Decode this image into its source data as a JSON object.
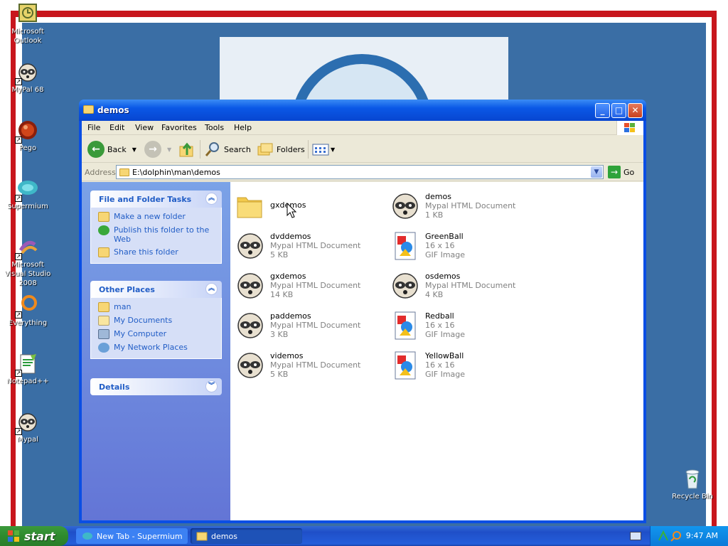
{
  "desktop": {
    "icons": [
      {
        "label": "Microsoft Outlook",
        "icon": "outlook-icon"
      },
      {
        "label": "MyPal 68",
        "icon": "raccoon-icon"
      },
      {
        "label": "Pego",
        "icon": "pego-icon"
      },
      {
        "label": "Supermium",
        "icon": "supermium-icon"
      },
      {
        "label": "Microsoft Visual Studio 2008",
        "icon": "visual-studio-icon"
      },
      {
        "label": "Everything",
        "icon": "everything-icon"
      },
      {
        "label": "Notepad++",
        "icon": "notepad-icon"
      },
      {
        "label": "Mypal",
        "icon": "raccoon-icon"
      },
      {
        "label": "Recycle Bin",
        "icon": "recycle-bin-icon"
      }
    ]
  },
  "window": {
    "title": "demos",
    "menu": [
      "File",
      "Edit",
      "View",
      "Favorites",
      "Tools",
      "Help"
    ],
    "toolbar": {
      "back": "Back",
      "search": "Search",
      "folders": "Folders"
    },
    "address": {
      "label": "Address",
      "value": "E:\\dolphin\\man\\demos",
      "go": "Go"
    }
  },
  "taskpane": {
    "file_tasks": {
      "title": "File and Folder Tasks",
      "items": [
        "Make a new folder",
        "Publish this folder to the Web",
        "Share this folder"
      ]
    },
    "other_places": {
      "title": "Other Places",
      "items": [
        "man",
        "My Documents",
        "My Computer",
        "My Network Places"
      ]
    },
    "details": {
      "title": "Details"
    }
  },
  "files": [
    {
      "name": "gxdemos",
      "type": "",
      "size": "",
      "icon": "folder-icon"
    },
    {
      "name": "demos",
      "type": "Mypal HTML Document",
      "size": "1 KB",
      "icon": "raccoon-icon"
    },
    {
      "name": "dvddemos",
      "type": "Mypal HTML Document",
      "size": "5 KB",
      "icon": "raccoon-icon"
    },
    {
      "name": "GreenBall",
      "type": "16 x 16",
      "size": "GIF Image",
      "icon": "gif-image-icon"
    },
    {
      "name": "gxdemos",
      "type": "Mypal HTML Document",
      "size": "14 KB",
      "icon": "raccoon-icon"
    },
    {
      "name": "osdemos",
      "type": "Mypal HTML Document",
      "size": "4 KB",
      "icon": "raccoon-icon"
    },
    {
      "name": "paddemos",
      "type": "Mypal HTML Document",
      "size": "3 KB",
      "icon": "raccoon-icon"
    },
    {
      "name": "Redball",
      "type": "16 x 16",
      "size": "GIF Image",
      "icon": "gif-image-icon"
    },
    {
      "name": "videmos",
      "type": "Mypal HTML Document",
      "size": "5 KB",
      "icon": "raccoon-icon"
    },
    {
      "name": "YellowBall",
      "type": "16 x 16",
      "size": "GIF Image",
      "icon": "gif-image-icon"
    }
  ],
  "taskbar": {
    "start": "start",
    "buttons": [
      "New Tab - Supermium",
      "demos"
    ],
    "clock": "9:47 AM"
  },
  "colors": {
    "wallpaper_blue": "#3a6ea5",
    "frame_red": "#c8161d",
    "xp_blue": "#0a4ee4",
    "link_blue": "#215dc6"
  }
}
